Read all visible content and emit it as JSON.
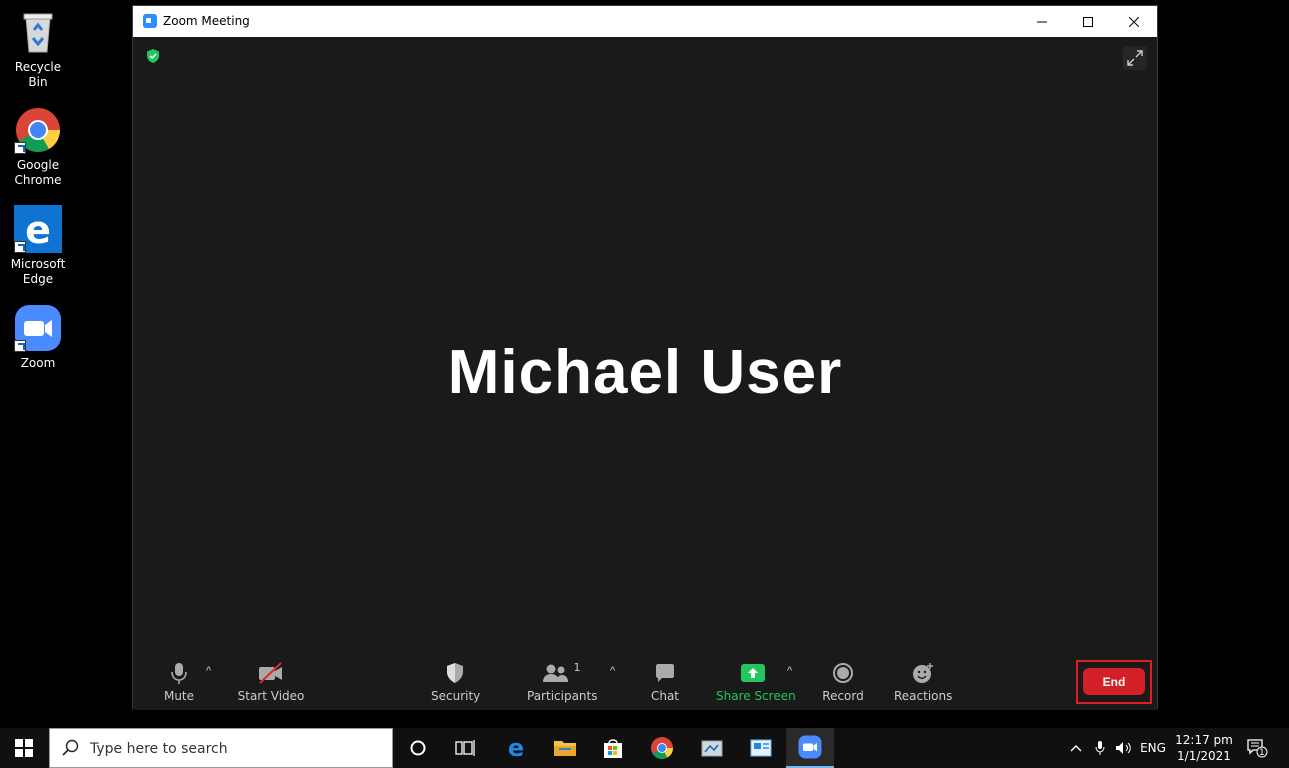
{
  "desktop": {
    "icons": [
      {
        "label": "Recycle Bin"
      },
      {
        "label": "Google Chrome"
      },
      {
        "label": "Microsoft Edge"
      },
      {
        "label": "Zoom"
      }
    ]
  },
  "window": {
    "title": "Zoom Meeting",
    "controls": {
      "minimize": "—",
      "maximize": "☐",
      "close": "✕"
    }
  },
  "meeting": {
    "participant_name": "Michael User"
  },
  "toolbar": {
    "mute_label": "Mute",
    "start_video_label": "Start Video",
    "security_label": "Security",
    "participants_label": "Participants",
    "participants_count": "1",
    "chat_label": "Chat",
    "share_screen_label": "Share Screen",
    "record_label": "Record",
    "reactions_label": "Reactions",
    "end_label": "End",
    "caret": "^"
  },
  "taskbar": {
    "search_placeholder": "Type here to search",
    "language": "ENG",
    "time": "12:17 pm",
    "date": "1/1/2021",
    "notification_count": "1"
  },
  "colors": {
    "end_button": "#d21f28",
    "share_screen": "#22c55e",
    "zoom_blue": "#2d8cff",
    "security_shield": "#22c55e"
  }
}
